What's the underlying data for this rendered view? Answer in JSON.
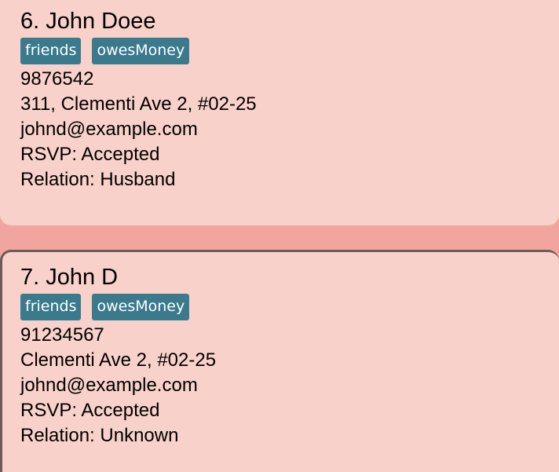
{
  "persons": [
    {
      "name": "6. John Doee",
      "tags": [
        "friends",
        "owesMoney"
      ],
      "phone": "9876542",
      "address": "311, Clementi Ave 2, #02-25",
      "email": "johnd@example.com",
      "rsvp": "RSVP: Accepted",
      "relation": "Relation: Husband"
    },
    {
      "name": "7. John D",
      "tags": [
        "friends",
        "owesMoney"
      ],
      "phone": "91234567",
      "address": "Clementi Ave 2, #02-25",
      "email": "johnd@example.com",
      "rsvp": "RSVP: Accepted",
      "relation": "Relation: Unknown"
    }
  ],
  "colors": {
    "background": "#f2a59e",
    "card": "#f8d2ca",
    "tag": "#3a7a8c",
    "selected_border": "#6e5a56"
  }
}
